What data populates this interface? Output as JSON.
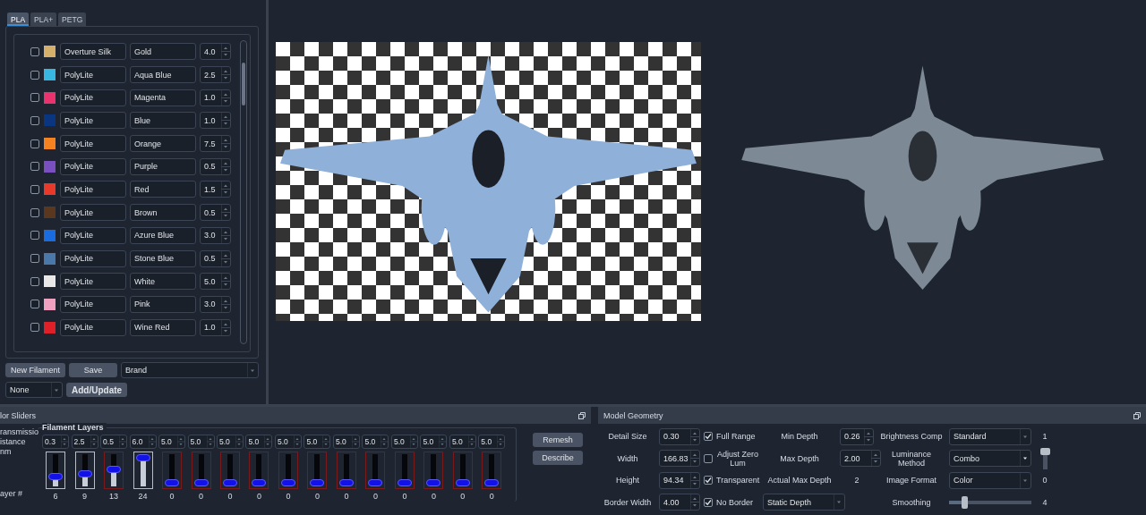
{
  "tabs": [
    {
      "label": "PLA",
      "selected": true
    },
    {
      "label": "PLA+",
      "selected": false
    },
    {
      "label": "PETG",
      "selected": false
    }
  ],
  "filaments": [
    {
      "checked": false,
      "color": "#d4b06a",
      "brand": "Overture Silk",
      "name": "Gold",
      "amount": "4.0"
    },
    {
      "checked": false,
      "color": "#38b8e0",
      "brand": "PolyLite",
      "name": "Aqua Blue",
      "amount": "2.5"
    },
    {
      "checked": false,
      "color": "#e8336f",
      "brand": "PolyLite",
      "name": "Magenta",
      "amount": "1.0"
    },
    {
      "checked": false,
      "color": "#0a3580",
      "brand": "PolyLite",
      "name": "Blue",
      "amount": "1.0"
    },
    {
      "checked": false,
      "color": "#f58220",
      "brand": "PolyLite",
      "name": "Orange",
      "amount": "7.5"
    },
    {
      "checked": false,
      "color": "#7a4fc0",
      "brand": "PolyLite",
      "name": "Purple",
      "amount": "0.5"
    },
    {
      "checked": false,
      "color": "#e8392a",
      "brand": "PolyLite",
      "name": "Red",
      "amount": "1.5"
    },
    {
      "checked": false,
      "color": "#5a3820",
      "brand": "PolyLite",
      "name": "Brown",
      "amount": "0.5"
    },
    {
      "checked": false,
      "color": "#1a6ae0",
      "brand": "PolyLite",
      "name": "Azure Blue",
      "amount": "3.0"
    },
    {
      "checked": false,
      "color": "#4a78a8",
      "brand": "PolyLite",
      "name": "Stone Blue",
      "amount": "0.5"
    },
    {
      "checked": false,
      "color": "#e8e8e8",
      "brand": "PolyLite",
      "name": "White",
      "amount": "5.0"
    },
    {
      "checked": false,
      "color": "#f0a0c0",
      "brand": "PolyLite",
      "name": "Pink",
      "amount": "3.0"
    },
    {
      "checked": false,
      "color": "#e02028",
      "brand": "PolyLite",
      "name": "Wine Red",
      "amount": "1.0"
    }
  ],
  "filament_actions": {
    "new_button": "New Filament",
    "save_button": "Save",
    "brand_select": "Brand",
    "preset_select": "None",
    "add_button": "Add/Update"
  },
  "previews": [
    {
      "kind": "transparent"
    },
    {
      "kind": "original"
    }
  ],
  "sliders_panel": {
    "title": "lor Sliders",
    "side_labels": [
      "ransmissio",
      "istance",
      "nm"
    ],
    "group_title": "Filament Layers",
    "layer_label": "ayer #",
    "buttons": [
      "Remesh",
      "Describe"
    ],
    "layers": [
      {
        "value": "0.3",
        "level": 0.25,
        "layer": "6",
        "active": true
      },
      {
        "value": "2.5",
        "level": 0.37,
        "layer": "9",
        "active": true
      },
      {
        "value": "0.5",
        "level": 0.54,
        "layer": "13",
        "active": false
      },
      {
        "value": "6.0",
        "level": 1,
        "layer": "24",
        "active": true
      },
      {
        "value": "5.0",
        "level": 0,
        "layer": "0",
        "active": false
      },
      {
        "value": "5.0",
        "level": 0,
        "layer": "0",
        "active": false
      },
      {
        "value": "5.0",
        "level": 0,
        "layer": "0",
        "active": false
      },
      {
        "value": "5.0",
        "level": 0,
        "layer": "0",
        "active": false
      },
      {
        "value": "5.0",
        "level": 0,
        "layer": "0",
        "active": false
      },
      {
        "value": "5.0",
        "level": 0,
        "layer": "0",
        "active": false
      },
      {
        "value": "5.0",
        "level": 0,
        "layer": "0",
        "active": false
      },
      {
        "value": "5.0",
        "level": 0,
        "layer": "0",
        "active": false
      },
      {
        "value": "5.0",
        "level": 0,
        "layer": "0",
        "active": false
      },
      {
        "value": "5.0",
        "level": 0,
        "layer": "0",
        "active": false
      },
      {
        "value": "5.0",
        "level": 0,
        "layer": "0",
        "active": false
      },
      {
        "value": "5.0",
        "level": 0,
        "layer": "0",
        "active": false
      }
    ]
  },
  "geometry": {
    "title": "Model Geometry",
    "cells": [
      {
        "kind": "label",
        "text": "Detail Size"
      },
      {
        "kind": "spin",
        "value": "0.30"
      },
      {
        "kind": "check",
        "label": "Full Range",
        "checked": true
      },
      {
        "kind": "label",
        "text": "Min Depth"
      },
      {
        "kind": "spin",
        "value": "0.26"
      },
      {
        "kind": "label",
        "text": "Brightness Comp"
      },
      {
        "kind": "select",
        "value": "Standard"
      },
      {
        "kind": "text",
        "text": "1"
      },
      {
        "kind": "label",
        "text": "Width"
      },
      {
        "kind": "spin",
        "value": "166.83"
      },
      {
        "kind": "check",
        "label": "Adjust Zero Lum",
        "checked": false
      },
      {
        "kind": "label",
        "text": "Max Depth"
      },
      {
        "kind": "spin",
        "value": "2.00"
      },
      {
        "kind": "label",
        "text": "Luminance Method"
      },
      {
        "kind": "select",
        "value": "Combo"
      },
      {
        "kind": "vslider",
        "level": 1
      },
      {
        "kind": "label",
        "text": "Height"
      },
      {
        "kind": "spin",
        "value": "94.34"
      },
      {
        "kind": "check",
        "label": "Transparent",
        "checked": true
      },
      {
        "kind": "label",
        "text": "Actual Max Depth"
      },
      {
        "kind": "text",
        "text": "2"
      },
      {
        "kind": "label",
        "text": "Image Format"
      },
      {
        "kind": "select",
        "value": "Color"
      },
      {
        "kind": "text",
        "text": "0"
      },
      {
        "kind": "label",
        "text": "Border Width"
      },
      {
        "kind": "spin",
        "value": "4.00"
      },
      {
        "kind": "check",
        "label": "No Border",
        "checked": true
      },
      {
        "kind": "wideselect",
        "value": "Static Depth"
      },
      {
        "kind": "label",
        "text": "Smoothing"
      },
      {
        "kind": "hslider",
        "level": 0.17
      },
      {
        "kind": "text",
        "text": "4"
      }
    ]
  }
}
